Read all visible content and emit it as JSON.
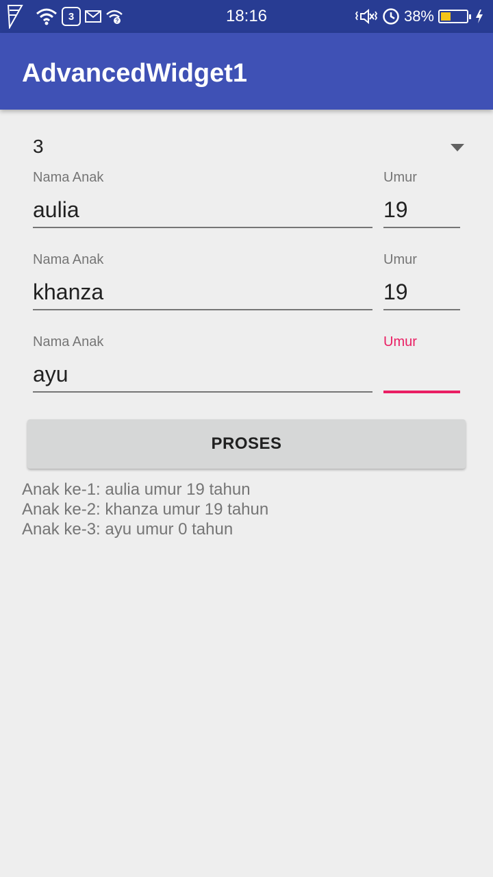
{
  "status_bar": {
    "time": "18:16",
    "notification_count": "3",
    "battery_percent": "38%",
    "battery_level": 0.38,
    "icons": [
      "app-logo-icon",
      "wifi-icon",
      "mail-icon",
      "wifi-question-icon",
      "vibrate-icon",
      "alarm-icon",
      "battery-icon",
      "charging-icon"
    ]
  },
  "app_bar": {
    "title": "AdvancedWidget1"
  },
  "spinner": {
    "value": "3"
  },
  "form": {
    "rows": [
      {
        "name_label": "Nama Anak",
        "name_value": "aulia",
        "age_label": "Umur",
        "age_value": "19"
      },
      {
        "name_label": "Nama Anak",
        "name_value": "khanza",
        "age_label": "Umur",
        "age_value": "19"
      },
      {
        "name_label": "Nama Anak",
        "name_value": "ayu",
        "age_label": "Umur",
        "age_value": ""
      }
    ]
  },
  "button": {
    "label": "PROSES"
  },
  "result": {
    "lines": [
      "Anak ke-1: aulia umur 19 tahun",
      "Anak ke-2: khanza umur 19 tahun",
      "Anak ke-3: ayu umur 0 tahun"
    ]
  },
  "colors": {
    "status_bar": "#283c93",
    "app_bar": "#3f51b5",
    "accent": "#e91e63",
    "background": "#eeeeee",
    "button": "#d6d7d7",
    "battery_fill": "#f5c518"
  }
}
